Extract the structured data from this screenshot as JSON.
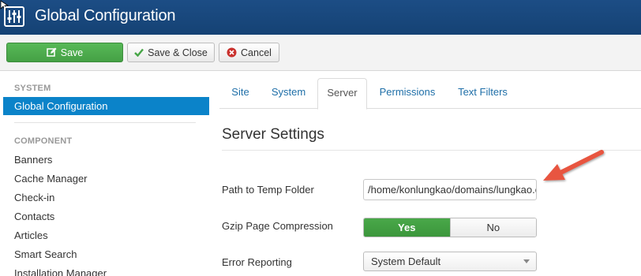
{
  "header": {
    "title": "Global Configuration",
    "icon": "sliders-icon",
    "bg": "#1a4a80"
  },
  "toolbar": {
    "save_label": "Save",
    "save_close_label": "Save & Close",
    "cancel_label": "Cancel"
  },
  "sidebar": {
    "system_header": "SYSTEM",
    "active_item": "Global Configuration",
    "component_header": "COMPONENT",
    "items": [
      "Banners",
      "Cache Manager",
      "Check-in",
      "Contacts",
      "Articles",
      "Smart Search",
      "Installation Manager"
    ]
  },
  "tabs": [
    {
      "label": "Site",
      "active": false
    },
    {
      "label": "System",
      "active": false
    },
    {
      "label": "Server",
      "active": true
    },
    {
      "label": "Permissions",
      "active": false
    },
    {
      "label": "Text Filters",
      "active": false
    }
  ],
  "main": {
    "section_title": "Server Settings",
    "fields": {
      "temp_path": {
        "label": "Path to Temp Folder",
        "value": "/home/konlungkao/domains/lungkao.com/public_html/tmp"
      },
      "gzip": {
        "label": "Gzip Page Compression",
        "yes": "Yes",
        "no": "No",
        "selected": "Yes"
      },
      "error_reporting": {
        "label": "Error Reporting",
        "value": "System Default"
      }
    }
  },
  "colors": {
    "accent": "#0b83c9",
    "success": "#46a546",
    "annotation_arrow": "#e8543f"
  }
}
